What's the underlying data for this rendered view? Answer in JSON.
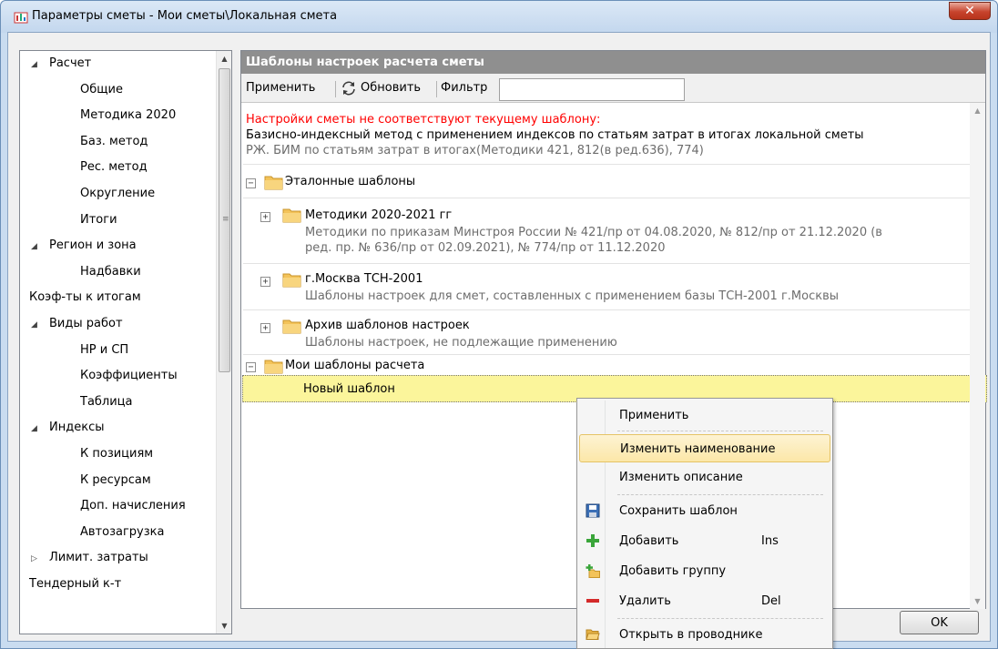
{
  "window": {
    "title": "Параметры сметы - Мои сметы\\Локальная смета",
    "close_glyph": "✕"
  },
  "sidebar": {
    "items": [
      {
        "label": "Расчет",
        "level": 0,
        "state": "expanded"
      },
      {
        "label": "Общие",
        "level": 1
      },
      {
        "label": "Методика 2020",
        "level": 1
      },
      {
        "label": "Баз. метод",
        "level": 1
      },
      {
        "label": "Рес. метод",
        "level": 1
      },
      {
        "label": "Округление",
        "level": 1
      },
      {
        "label": "Итоги",
        "level": 1
      },
      {
        "label": "Регион и зона",
        "level": 0,
        "state": "expanded"
      },
      {
        "label": "Надбавки",
        "level": 1
      },
      {
        "label": "Коэф-ты к итогам",
        "level": 0,
        "state": "none"
      },
      {
        "label": "Виды работ",
        "level": 0,
        "state": "expanded"
      },
      {
        "label": "НР и СП",
        "level": 1
      },
      {
        "label": "Коэффициенты",
        "level": 1
      },
      {
        "label": "Таблица",
        "level": 1
      },
      {
        "label": "Индексы",
        "level": 0,
        "state": "expanded"
      },
      {
        "label": "К позициям",
        "level": 1
      },
      {
        "label": "К ресурсам",
        "level": 1
      },
      {
        "label": "Доп. начисления",
        "level": 1
      },
      {
        "label": "Автозагрузка",
        "level": 1
      },
      {
        "label": "Лимит. затраты",
        "level": 0,
        "state": "collapsed"
      },
      {
        "label": "Тендерный к-т",
        "level": 0,
        "state": "none"
      }
    ]
  },
  "panel": {
    "header": "Шаблоны настроек расчета сметы",
    "toolbar": {
      "apply_label": "Применить",
      "refresh_label": "Обновить",
      "filter_label": "Фильтр",
      "filter_value": ""
    },
    "warning": "Настройки сметы не соответствуют текущему шаблону:",
    "method": "Базисно-индексный метод с применением индексов по статьям затрат в итогах локальной сметы",
    "method_sub": "РЖ. БИМ по статьям затрат в итогах(Методики 421, 812(в ред.636), 774)",
    "groups": {
      "reference": {
        "title": "Эталонные шаблоны",
        "children": [
          {
            "title": "Методики 2020-2021 гг",
            "desc_line1": "Методики по приказам Минстроя России № 421/пр от 04.08.2020, № 812/пр от 21.12.2020 (в",
            "desc_line2": "ред. пр. № 636/пр от 02.09.2021), № 774/пр от 11.12.2020"
          },
          {
            "title": "г.Москва ТСН-2001",
            "desc_line1": "Шаблоны настроек для смет, составленных с применением базы ТСН-2001 г.Москвы"
          },
          {
            "title": "Архив шаблонов настроек",
            "desc_line1": "Шаблоны настроек, не подлежащие применению"
          }
        ]
      },
      "mine": {
        "title": "Мои шаблоны расчета",
        "selected_item": "Новый шаблон"
      }
    }
  },
  "ok_label": "OK",
  "context_menu": {
    "items": [
      {
        "label": "Применить",
        "shortcut": "",
        "icon": "none"
      },
      {
        "label": "Изменить наименование",
        "shortcut": "",
        "icon": "none",
        "highlighted": true
      },
      {
        "label": "Изменить описание",
        "shortcut": "",
        "icon": "none"
      },
      {
        "label": "Сохранить шаблон",
        "shortcut": "",
        "icon": "save-icon"
      },
      {
        "label": "Добавить",
        "shortcut": "Ins",
        "icon": "add-icon"
      },
      {
        "label": "Добавить группу",
        "shortcut": "",
        "icon": "add-group-icon"
      },
      {
        "label": "Удалить",
        "shortcut": "Del",
        "icon": "delete-icon"
      },
      {
        "label": "Открыть в проводнике",
        "shortcut": "",
        "icon": "folder-open-icon"
      }
    ]
  },
  "colors": {
    "warning": "#ff0000",
    "selection": "#fbf59b",
    "header_bg": "#8f8f8f",
    "folder": "#f3c35a"
  }
}
